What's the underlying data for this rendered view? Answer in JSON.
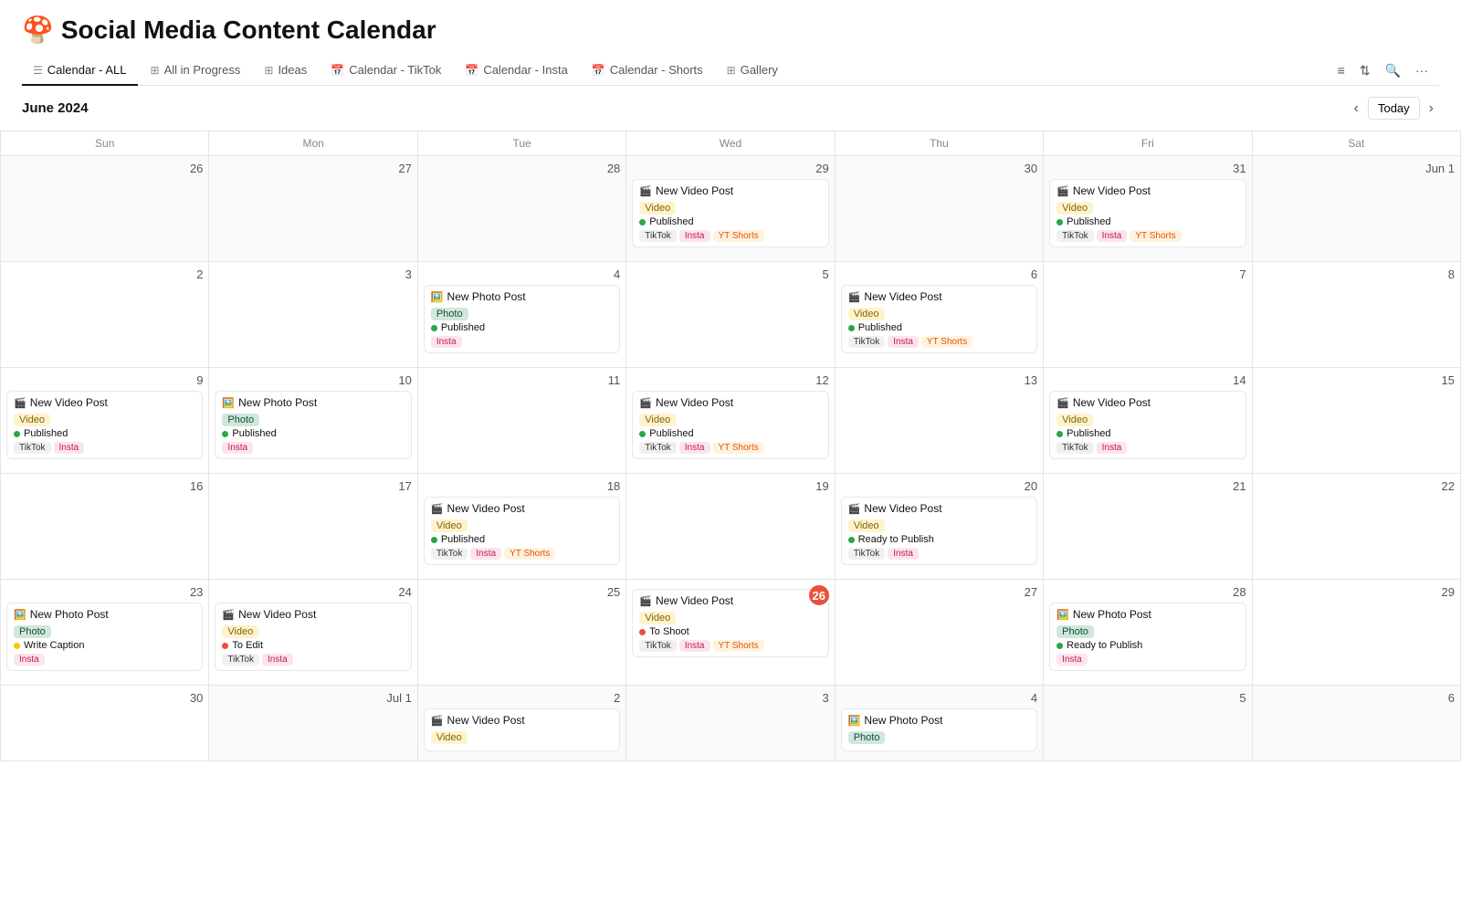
{
  "app": {
    "emoji": "🍄",
    "title": "Social Media Content Calendar"
  },
  "nav": {
    "tabs": [
      {
        "id": "calendar-all",
        "label": "Calendar - ALL",
        "icon": "☰",
        "active": true
      },
      {
        "id": "all-in-progress",
        "label": "All in Progress",
        "icon": "⊞",
        "active": false
      },
      {
        "id": "ideas",
        "label": "Ideas",
        "icon": "⊞",
        "active": false
      },
      {
        "id": "calendar-tiktok",
        "label": "Calendar - TikTok",
        "icon": "📅",
        "active": false
      },
      {
        "id": "calendar-insta",
        "label": "Calendar - Insta",
        "icon": "📅",
        "active": false
      },
      {
        "id": "calendar-shorts",
        "label": "Calendar - Shorts",
        "icon": "📅",
        "active": false
      },
      {
        "id": "gallery",
        "label": "Gallery",
        "icon": "⊞",
        "active": false
      }
    ]
  },
  "calendar": {
    "month": "June 2024",
    "today_btn": "Today",
    "day_headers": [
      "Sun",
      "Mon",
      "Tue",
      "Wed",
      "Thu",
      "Fri",
      "Sat"
    ]
  },
  "weeks": [
    {
      "days": [
        {
          "date": "26",
          "other": true,
          "events": []
        },
        {
          "date": "27",
          "other": true,
          "events": []
        },
        {
          "date": "28",
          "other": true,
          "events": []
        },
        {
          "date": "29",
          "other": true,
          "events": [
            {
              "emoji": "🎬",
              "title": "New Video Post",
              "type": "Video",
              "type_class": "tag-video",
              "status": "Published",
              "status_class": "status-published",
              "platforms": [
                "TikTok",
                "Insta",
                "YT Shorts"
              ]
            }
          ]
        },
        {
          "date": "30",
          "other": true,
          "events": []
        },
        {
          "date": "31",
          "other": true,
          "events": [
            {
              "emoji": "🎬",
              "title": "New Video Post",
              "type": "Video",
              "type_class": "tag-video",
              "status": "Published",
              "status_class": "status-published",
              "platforms": [
                "TikTok",
                "Insta",
                "YT Shorts"
              ]
            }
          ]
        },
        {
          "date": "Jun 1",
          "other": true,
          "events": []
        }
      ]
    },
    {
      "days": [
        {
          "date": "2",
          "other": false,
          "events": []
        },
        {
          "date": "3",
          "other": false,
          "events": []
        },
        {
          "date": "4",
          "other": false,
          "events": [
            {
              "emoji": "🖼️",
              "title": "New Photo Post",
              "type": "Photo",
              "type_class": "tag-photo",
              "status": "Published",
              "status_class": "status-published",
              "platforms": [
                "Insta"
              ]
            }
          ]
        },
        {
          "date": "5",
          "other": false,
          "events": []
        },
        {
          "date": "6",
          "other": false,
          "events": [
            {
              "emoji": "🎬",
              "title": "New Video Post",
              "type": "Video",
              "type_class": "tag-video",
              "status": "Published",
              "status_class": "status-published",
              "platforms": [
                "TikTok",
                "Insta",
                "YT Shorts"
              ]
            }
          ]
        },
        {
          "date": "7",
          "other": false,
          "events": []
        },
        {
          "date": "8",
          "other": false,
          "events": []
        }
      ]
    },
    {
      "days": [
        {
          "date": "9",
          "other": false,
          "events": [
            {
              "emoji": "🎬",
              "title": "New Video Post",
              "type": "Video",
              "type_class": "tag-video",
              "status": "Published",
              "status_class": "status-published",
              "platforms": [
                "TikTok",
                "Insta"
              ]
            }
          ]
        },
        {
          "date": "10",
          "other": false,
          "events": [
            {
              "emoji": "🖼️",
              "title": "New Photo Post",
              "type": "Photo",
              "type_class": "tag-photo",
              "status": "Published",
              "status_class": "status-published",
              "platforms": [
                "Insta"
              ]
            }
          ]
        },
        {
          "date": "11",
          "other": false,
          "events": []
        },
        {
          "date": "12",
          "other": false,
          "events": [
            {
              "emoji": "🎬",
              "title": "New Video Post",
              "type": "Video",
              "type_class": "tag-video",
              "status": "Published",
              "status_class": "status-published",
              "platforms": [
                "TikTok",
                "Insta",
                "YT Shorts"
              ]
            }
          ]
        },
        {
          "date": "13",
          "other": false,
          "events": []
        },
        {
          "date": "14",
          "other": false,
          "events": [
            {
              "emoji": "🎬",
              "title": "New Video Post",
              "type": "Video",
              "type_class": "tag-video",
              "status": "Published",
              "status_class": "status-published",
              "platforms": [
                "TikTok",
                "Insta"
              ]
            }
          ]
        },
        {
          "date": "15",
          "other": false,
          "events": []
        }
      ]
    },
    {
      "days": [
        {
          "date": "16",
          "other": false,
          "events": []
        },
        {
          "date": "17",
          "other": false,
          "events": []
        },
        {
          "date": "18",
          "other": false,
          "events": [
            {
              "emoji": "🎬",
              "title": "New Video Post",
              "type": "Video",
              "type_class": "tag-video",
              "status": "Published",
              "status_class": "status-published",
              "platforms": [
                "TikTok",
                "Insta",
                "YT Shorts"
              ]
            }
          ]
        },
        {
          "date": "19",
          "other": false,
          "events": []
        },
        {
          "date": "20",
          "other": false,
          "events": [
            {
              "emoji": "🎬",
              "title": "New Video Post",
              "type": "Video",
              "type_class": "tag-video",
              "status": "Ready to Publish",
              "status_class": "status-ready",
              "platforms": [
                "TikTok",
                "Insta"
              ]
            }
          ]
        },
        {
          "date": "21",
          "other": false,
          "events": []
        },
        {
          "date": "22",
          "other": false,
          "events": []
        }
      ]
    },
    {
      "days": [
        {
          "date": "23",
          "other": false,
          "events": [
            {
              "emoji": "🖼️",
              "title": "New Photo Post",
              "type": "Photo",
              "type_class": "tag-photo",
              "status": "Write Caption",
              "status_class": "status-write-caption",
              "platforms": [
                "Insta"
              ]
            }
          ]
        },
        {
          "date": "24",
          "other": false,
          "events": [
            {
              "emoji": "🎬",
              "title": "New Video Post",
              "type": "Video",
              "type_class": "tag-video",
              "status": "To Edit",
              "status_class": "status-to-edit",
              "platforms": [
                "TikTok",
                "Insta"
              ]
            }
          ]
        },
        {
          "date": "25",
          "other": false,
          "events": []
        },
        {
          "date": "26",
          "other": false,
          "today": true,
          "events": [
            {
              "emoji": "🎬",
              "title": "New Video Post",
              "type": "Video",
              "type_class": "tag-video",
              "status": "To Shoot",
              "status_class": "status-to-shoot",
              "platforms": [
                "TikTok",
                "Insta",
                "YT Shorts"
              ]
            }
          ]
        },
        {
          "date": "27",
          "other": false,
          "events": []
        },
        {
          "date": "28",
          "other": false,
          "events": [
            {
              "emoji": "🖼️",
              "title": "New Photo Post",
              "type": "Photo",
              "type_class": "tag-photo",
              "status": "Ready to Publish",
              "status_class": "status-ready",
              "platforms": [
                "Insta"
              ]
            }
          ]
        },
        {
          "date": "29",
          "other": false,
          "events": []
        }
      ]
    },
    {
      "days": [
        {
          "date": "30",
          "other": false,
          "events": []
        },
        {
          "date": "Jul 1",
          "other": true,
          "events": []
        },
        {
          "date": "2",
          "other": true,
          "events": [
            {
              "emoji": "🎬",
              "title": "New Video Post",
              "type": "Video",
              "type_class": "tag-video",
              "status": "",
              "status_class": "",
              "platforms": []
            }
          ]
        },
        {
          "date": "3",
          "other": true,
          "events": []
        },
        {
          "date": "4",
          "other": true,
          "events": [
            {
              "emoji": "🖼️",
              "title": "New Photo Post",
              "type": "Photo",
              "type_class": "tag-photo",
              "status": "",
              "status_class": "",
              "platforms": []
            }
          ]
        },
        {
          "date": "5",
          "other": true,
          "events": []
        },
        {
          "date": "6",
          "other": true,
          "events": []
        }
      ]
    }
  ],
  "bottom_bar": {
    "new_photo": "New Photo Post",
    "new_video": "New Video Post"
  }
}
